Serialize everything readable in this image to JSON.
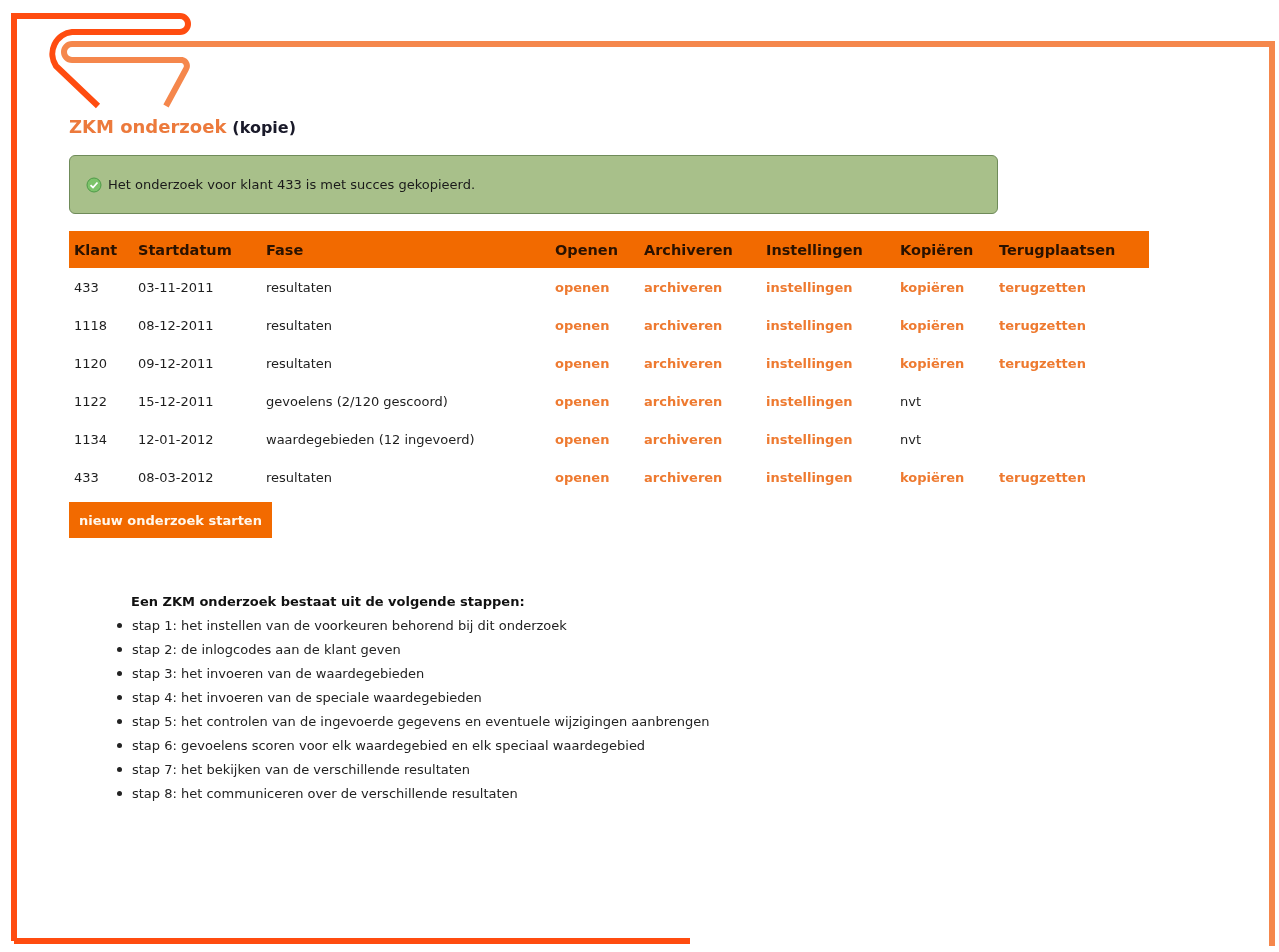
{
  "title": {
    "main": "ZKM onderzoek",
    "sub": "(kopie)"
  },
  "message": {
    "text": "Het onderzoek voor klant 433 is met succes gekopieerd."
  },
  "table": {
    "columns": [
      "Klant",
      "Startdatum",
      "Fase",
      "Openen",
      "Archiveren",
      "Instellingen",
      "Kopiëren",
      "Terugplaatsen"
    ],
    "rows": [
      {
        "cells": [
          {
            "kind": "text",
            "text": "433"
          },
          {
            "kind": "text",
            "text": "03-11-2011"
          },
          {
            "kind": "text",
            "text": "resultaten"
          },
          {
            "kind": "link",
            "text": "openen"
          },
          {
            "kind": "link",
            "text": "archiveren"
          },
          {
            "kind": "link",
            "text": "instellingen"
          },
          {
            "kind": "link",
            "text": "kopiëren"
          },
          {
            "kind": "link",
            "text": "terugzetten"
          }
        ]
      },
      {
        "cells": [
          {
            "kind": "text",
            "text": "1118"
          },
          {
            "kind": "text",
            "text": "08-12-2011"
          },
          {
            "kind": "text",
            "text": "resultaten"
          },
          {
            "kind": "link",
            "text": "openen"
          },
          {
            "kind": "link",
            "text": "archiveren"
          },
          {
            "kind": "link",
            "text": "instellingen"
          },
          {
            "kind": "link",
            "text": "kopiëren"
          },
          {
            "kind": "link",
            "text": "terugzetten"
          }
        ]
      },
      {
        "cells": [
          {
            "kind": "text",
            "text": "1120"
          },
          {
            "kind": "text",
            "text": "09-12-2011"
          },
          {
            "kind": "text",
            "text": "resultaten"
          },
          {
            "kind": "link",
            "text": "openen"
          },
          {
            "kind": "link",
            "text": "archiveren"
          },
          {
            "kind": "link",
            "text": "instellingen"
          },
          {
            "kind": "link",
            "text": "kopiëren"
          },
          {
            "kind": "link",
            "text": "terugzetten"
          }
        ]
      },
      {
        "cells": [
          {
            "kind": "text",
            "text": "1122"
          },
          {
            "kind": "text",
            "text": "15-12-2011"
          },
          {
            "kind": "text",
            "text": "gevoelens (2/120 gescoord)"
          },
          {
            "kind": "link",
            "text": "openen"
          },
          {
            "kind": "link",
            "text": "archiveren"
          },
          {
            "kind": "link",
            "text": "instellingen"
          },
          {
            "kind": "text",
            "text": "nvt"
          }
        ]
      },
      {
        "cells": [
          {
            "kind": "text",
            "text": "1134"
          },
          {
            "kind": "text",
            "text": "12-01-2012"
          },
          {
            "kind": "text",
            "text": "waardegebieden (12 ingevoerd)"
          },
          {
            "kind": "link",
            "text": "openen"
          },
          {
            "kind": "link",
            "text": "archiveren"
          },
          {
            "kind": "link",
            "text": "instellingen"
          },
          {
            "kind": "text",
            "text": "nvt"
          }
        ]
      },
      {
        "cells": [
          {
            "kind": "text",
            "text": "433"
          },
          {
            "kind": "text",
            "text": "08-03-2012"
          },
          {
            "kind": "text",
            "text": "resultaten"
          },
          {
            "kind": "link",
            "text": "openen"
          },
          {
            "kind": "link",
            "text": "archiveren"
          },
          {
            "kind": "link",
            "text": "instellingen"
          },
          {
            "kind": "link",
            "text": "kopiëren"
          },
          {
            "kind": "link",
            "text": "terugzetten"
          }
        ]
      }
    ]
  },
  "new_button": "nieuw onderzoek starten",
  "steps": {
    "heading": "Een ZKM onderzoek bestaat uit de volgende stappen:",
    "items": [
      "stap 1: het instellen van de voorkeuren behorend bij dit onderzoek",
      "stap 2: de inlogcodes aan de klant geven",
      "stap 3: het invoeren van de waardegebieden",
      "stap 4: het invoeren van de speciale waardegebieden",
      "stap 5: het controlen van de ingevoerde gegevens en eventuele wijzigingen aanbrengen",
      "stap 6: gevoelens scoren voor elk waardegebied en elk speciaal waardegebied",
      "stap 7: het bekijken van de verschillende resultaten",
      "stap 8: het communiceren over de verschillende resultaten"
    ]
  }
}
